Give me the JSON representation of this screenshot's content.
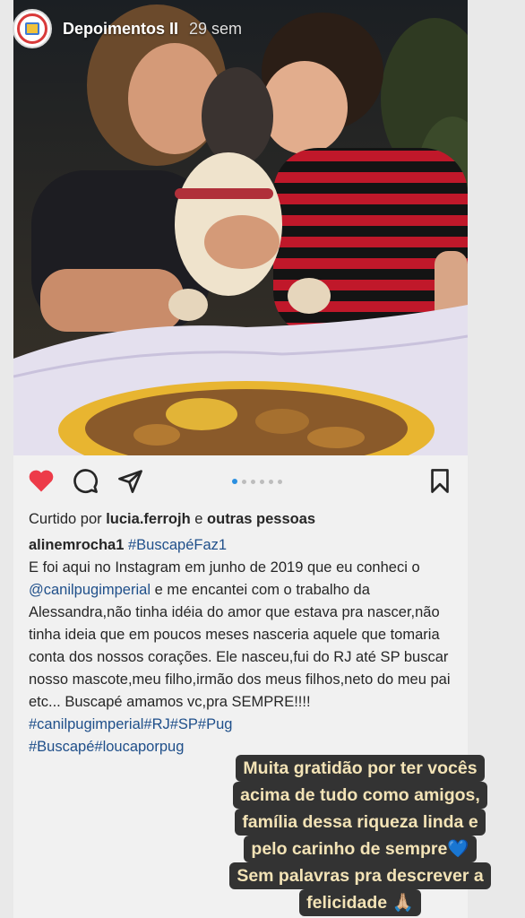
{
  "header": {
    "username": "Depoimentos II",
    "time": "29 sem"
  },
  "post": {
    "carousel_dots": 6,
    "active_dot": 0,
    "likes": {
      "prefix": "Curtido por ",
      "user": "lucia.ferrojh",
      "middle": " e ",
      "others": "outras pessoas"
    },
    "caption": {
      "handle": "alinemrocha1",
      "tag1": "#BuscapéFaz1",
      "text1": "E foi aqui no Instagram em junho de 2019 que eu conheci o ",
      "mention": "@canilpugimperial",
      "text2": " e me encantei com o trabalho da Alessandra,não tinha idéia do amor que estava pra nascer,não tinha ideia que em poucos meses nasceria aquele que tomaria conta dos nossos corações. Ele nasceu,fui do  RJ até SP buscar nosso mascote,meu filho,irmão dos meus filhos,neto do meu pai etc... Buscapé amamos vc,pra SEMPRE!!!!",
      "tags2": "#canilpugimperial#RJ#SP#Pug",
      "tags3": "#Buscapé#loucaporpug"
    }
  },
  "sticker": {
    "lines": [
      "Muita gratidão por ter vocês",
      "acima de tudo como amigos,",
      "família dessa riqueza linda e",
      "pelo carinho de sempre💙",
      "Sem palavras pra descrever a",
      "felicidade 🙏🏼"
    ]
  }
}
